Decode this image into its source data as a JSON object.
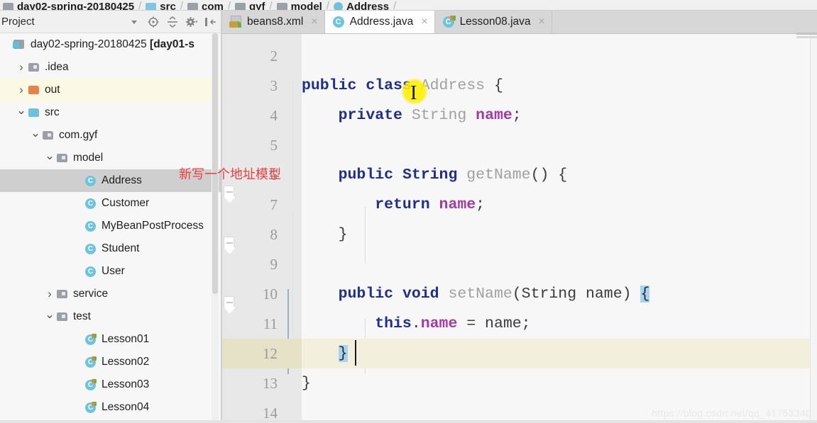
{
  "breadcrumb": {
    "items": [
      {
        "label": "day02-spring-20180425",
        "icon": "project-icon"
      },
      {
        "label": "src",
        "icon": "folder-blue-icon"
      },
      {
        "label": "com",
        "icon": "folder-gray-icon"
      },
      {
        "label": "gyf",
        "icon": "folder-gray-icon"
      },
      {
        "label": "model",
        "icon": "folder-gray-icon"
      },
      {
        "label": "Address",
        "icon": "java-class-icon"
      }
    ],
    "separator": "/"
  },
  "project_panel": {
    "title": "Project",
    "tools": [
      {
        "name": "view-mode-dropdown",
        "glyph": "▾"
      },
      {
        "name": "locate-target-icon",
        "glyph": "target"
      },
      {
        "name": "collapse-all-icon",
        "glyph": "collapse"
      },
      {
        "name": "settings-gear-icon",
        "glyph": "gear"
      },
      {
        "name": "hide-panel-icon",
        "glyph": "hide"
      }
    ],
    "tree": [
      {
        "label": "day02-spring-20180425 [day01-s",
        "icon": "project-icon",
        "indent": 0,
        "arrow": "none",
        "state": "normal",
        "bold_from": 22
      },
      {
        "label": ".idea",
        "icon": "folder-gray-icon",
        "indent": 1,
        "arrow": "closed",
        "state": "normal"
      },
      {
        "label": "out",
        "icon": "folder-orange-icon",
        "indent": 1,
        "arrow": "closed",
        "state": "highlight"
      },
      {
        "label": "src",
        "icon": "folder-blue-icon",
        "indent": 1,
        "arrow": "open",
        "state": "normal"
      },
      {
        "label": "com.gyf",
        "icon": "folder-gray-icon",
        "indent": 2,
        "arrow": "open",
        "state": "normal"
      },
      {
        "label": "model",
        "icon": "folder-gray-icon",
        "indent": 3,
        "arrow": "open",
        "state": "normal"
      },
      {
        "label": "Address",
        "icon": "java-class-icon",
        "indent": 5,
        "arrow": "none",
        "state": "selected"
      },
      {
        "label": "Customer",
        "icon": "java-class-icon",
        "indent": 5,
        "arrow": "none",
        "state": "normal"
      },
      {
        "label": "MyBeanPostProcess",
        "icon": "java-class-icon",
        "indent": 5,
        "arrow": "none",
        "state": "normal"
      },
      {
        "label": "Student",
        "icon": "java-class-icon",
        "indent": 5,
        "arrow": "none",
        "state": "normal"
      },
      {
        "label": "User",
        "icon": "java-class-icon",
        "indent": 5,
        "arrow": "none",
        "state": "normal"
      },
      {
        "label": "service",
        "icon": "folder-gray-icon",
        "indent": 3,
        "arrow": "closed",
        "state": "normal"
      },
      {
        "label": "test",
        "icon": "folder-gray-icon",
        "indent": 3,
        "arrow": "open",
        "state": "normal"
      },
      {
        "label": "Lesson01",
        "icon": "java-test-class-icon",
        "indent": 5,
        "arrow": "none",
        "state": "normal"
      },
      {
        "label": "Lesson02",
        "icon": "java-test-class-icon",
        "indent": 5,
        "arrow": "none",
        "state": "normal"
      },
      {
        "label": "Lesson03",
        "icon": "java-test-class-icon",
        "indent": 5,
        "arrow": "none",
        "state": "normal"
      },
      {
        "label": "Lesson04",
        "icon": "java-test-class-icon",
        "indent": 5,
        "arrow": "none",
        "state": "normal"
      }
    ]
  },
  "editor": {
    "tabs": [
      {
        "label": "beans8.xml",
        "icon": "xml-spring-icon",
        "active": false,
        "close": "×"
      },
      {
        "label": "Address.java",
        "icon": "java-class-icon",
        "active": true,
        "close": "×"
      },
      {
        "label": "Lesson08.java",
        "icon": "java-test-class-icon",
        "active": false,
        "close": "×"
      }
    ],
    "first_visible_line": 2,
    "caret_line": 12,
    "highlighted_line": 12,
    "lines": [
      {
        "num": "2",
        "tokens": []
      },
      {
        "num": "3",
        "tokens": [
          {
            "t": "public",
            "c": "kw"
          },
          {
            "t": " ",
            "c": "pln"
          },
          {
            "t": "class",
            "c": "kw"
          },
          {
            "t": " ",
            "c": "pln"
          },
          {
            "t": "Address",
            "c": "id"
          },
          {
            "t": " ",
            "c": "pln"
          },
          {
            "t": "{",
            "c": "brc"
          }
        ]
      },
      {
        "num": "4",
        "tokens": [
          {
            "t": "    ",
            "c": "pln"
          },
          {
            "t": "private",
            "c": "kw"
          },
          {
            "t": " ",
            "c": "pln"
          },
          {
            "t": "String",
            "c": "id"
          },
          {
            "t": " ",
            "c": "pln"
          },
          {
            "t": "name",
            "c": "fld"
          },
          {
            "t": ";",
            "c": "pln"
          }
        ]
      },
      {
        "num": "5",
        "tokens": []
      },
      {
        "num": "6",
        "tokens": [
          {
            "t": "    ",
            "c": "pln"
          },
          {
            "t": "public",
            "c": "kw"
          },
          {
            "t": " ",
            "c": "pln"
          },
          {
            "t": "String",
            "c": "kw"
          },
          {
            "t": " ",
            "c": "pln"
          },
          {
            "t": "getName",
            "c": "id"
          },
          {
            "t": "() {",
            "c": "pln"
          }
        ]
      },
      {
        "num": "7",
        "tokens": [
          {
            "t": "        ",
            "c": "pln"
          },
          {
            "t": "return",
            "c": "kw"
          },
          {
            "t": " ",
            "c": "pln"
          },
          {
            "t": "name",
            "c": "fld"
          },
          {
            "t": ";",
            "c": "pln"
          }
        ]
      },
      {
        "num": "8",
        "tokens": [
          {
            "t": "    }",
            "c": "pln"
          }
        ]
      },
      {
        "num": "9",
        "tokens": []
      },
      {
        "num": "10",
        "tokens": [
          {
            "t": "    ",
            "c": "pln"
          },
          {
            "t": "public",
            "c": "kw"
          },
          {
            "t": " ",
            "c": "pln"
          },
          {
            "t": "void",
            "c": "kw"
          },
          {
            "t": " ",
            "c": "pln"
          },
          {
            "t": "setName",
            "c": "id"
          },
          {
            "t": "(String name) ",
            "c": "pln"
          },
          {
            "t": "{",
            "c": "brc-hl"
          }
        ]
      },
      {
        "num": "11",
        "tokens": [
          {
            "t": "        ",
            "c": "pln"
          },
          {
            "t": "this",
            "c": "kw"
          },
          {
            "t": ".",
            "c": "pln"
          },
          {
            "t": "name",
            "c": "fld"
          },
          {
            "t": " = name;",
            "c": "pln"
          }
        ]
      },
      {
        "num": "12",
        "tokens": [
          {
            "t": "    ",
            "c": "pln"
          },
          {
            "t": "}",
            "c": "brc-hl"
          }
        ]
      },
      {
        "num": "13",
        "tokens": [
          {
            "t": "}",
            "c": "pln"
          }
        ]
      },
      {
        "num": "14",
        "tokens": []
      }
    ]
  },
  "annotation": {
    "text": "新写一个地址模型",
    "color": "#ef3d3d"
  },
  "watermark": {
    "text": "https://blog.csdn.net/qq_41753340"
  },
  "colors": {
    "keyword": "#1f2f8a",
    "identifier": "#a0a0a0",
    "field": "#a33ba3",
    "highlight_line": "#f2f0dd",
    "selection": "#a8d4f0",
    "tree_selected": "#cfcfcf",
    "tree_highlight": "#fbf8e4"
  }
}
